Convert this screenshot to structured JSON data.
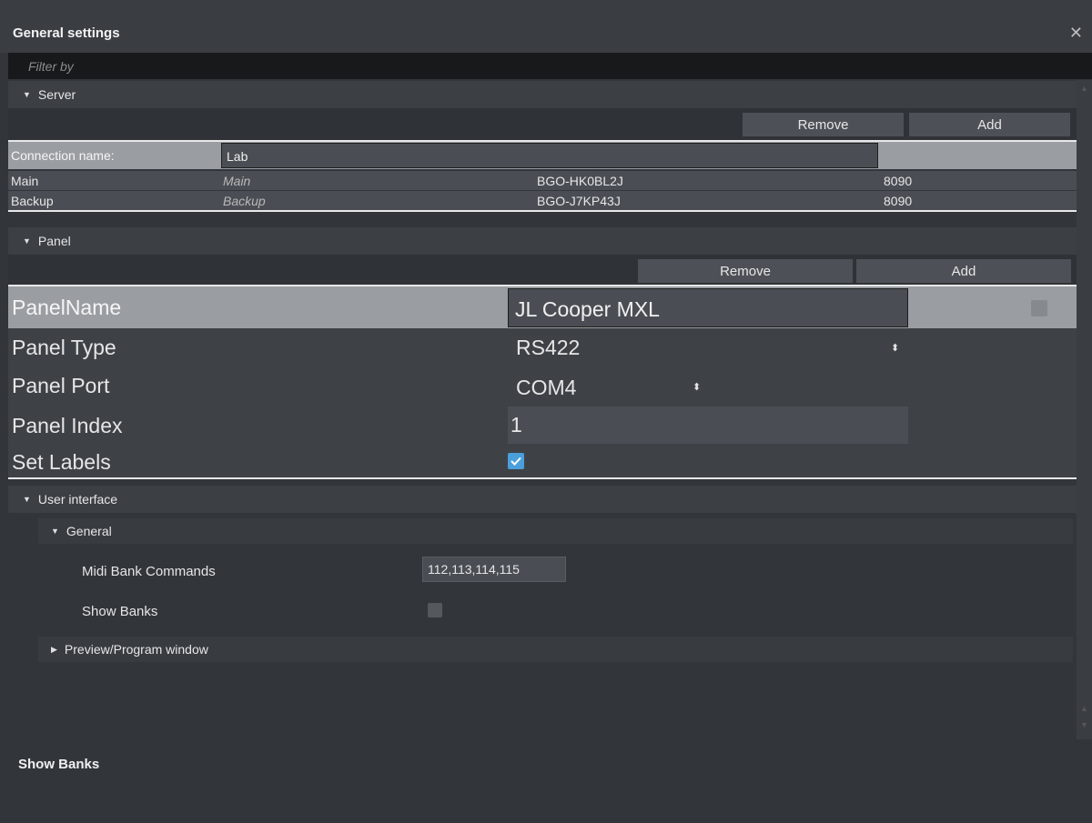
{
  "window": {
    "title": "General settings",
    "close_glyph": "✕"
  },
  "filter": {
    "placeholder": "Filter by",
    "value": ""
  },
  "server": {
    "header": "Server",
    "remove_label": "Remove",
    "add_label": "Add",
    "connection_label": "Connection name:",
    "connection_value": "Lab",
    "rows": [
      {
        "name": "Main",
        "alias": "Main",
        "host": "BGO-HK0BL2J",
        "port": "8090"
      },
      {
        "name": "Backup",
        "alias": "Backup",
        "host": "BGO-J7KP43J",
        "port": "8090"
      }
    ]
  },
  "panel": {
    "header": "Panel",
    "remove_label": "Remove",
    "add_label": "Add",
    "name_label": "PanelName",
    "name_value": "JL Cooper MXL",
    "type_label": "Panel Type",
    "type_value": "RS422",
    "port_label": "Panel Port",
    "port_value": "COM4",
    "index_label": "Panel Index",
    "index_value": "1",
    "labels_label": "Set Labels",
    "labels_checked": true
  },
  "user_interface": {
    "header": "User interface",
    "general": {
      "header": "General",
      "midi_label": "Midi Bank Commands",
      "midi_value": "112,113,114,115",
      "show_banks_label": "Show Banks",
      "show_banks_checked": false
    },
    "preview_header": "Preview/Program window"
  },
  "footer": {
    "description_title": "Show Banks"
  },
  "colors": {
    "accent": "#4a9fdb",
    "selected_row": "#9a9ea3",
    "background": "#32363b"
  },
  "icons": {
    "expanded": "triangle-down-icon",
    "collapsed": "triangle-right-icon",
    "select": "updown-icon"
  }
}
